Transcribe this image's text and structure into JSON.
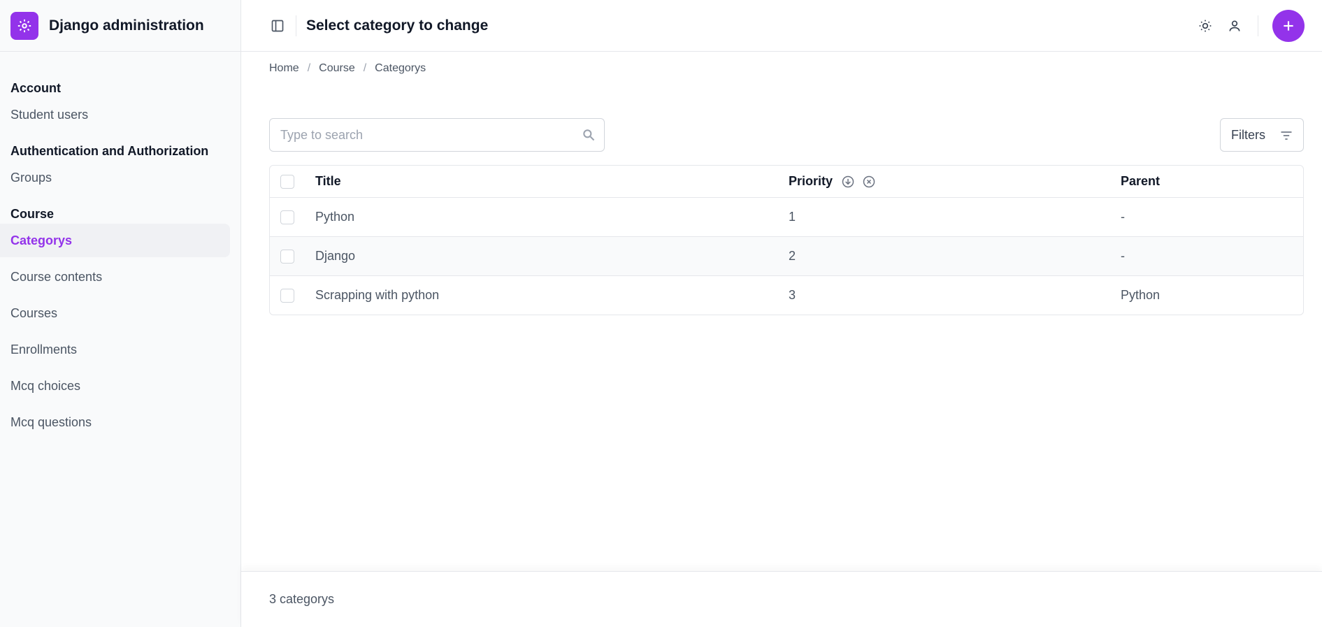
{
  "brand": {
    "title": "Django administration",
    "icon": "gear-icon"
  },
  "sidebar": {
    "groups": [
      {
        "title": "Account",
        "items": [
          {
            "label": "Student users"
          }
        ]
      },
      {
        "title": "Authentication and Authorization",
        "items": [
          {
            "label": "Groups"
          }
        ]
      },
      {
        "title": "Course",
        "items": [
          {
            "label": "Categorys",
            "active": true
          },
          {
            "label": "Course contents"
          },
          {
            "label": "Courses"
          },
          {
            "label": "Enrollments"
          },
          {
            "label": "Mcq choices"
          },
          {
            "label": "Mcq questions"
          }
        ]
      }
    ]
  },
  "header": {
    "title": "Select category to change",
    "add_icon": "plus-icon"
  },
  "breadcrumb": [
    "Home",
    "Course",
    "Categorys"
  ],
  "search": {
    "placeholder": "Type to search",
    "value": ""
  },
  "filters": {
    "label": "Filters"
  },
  "table": {
    "columns": [
      "Title",
      "Priority",
      "Parent"
    ],
    "rows": [
      {
        "title": "Python",
        "priority": "1",
        "parent": "-"
      },
      {
        "title": "Django",
        "priority": "2",
        "parent": "-"
      },
      {
        "title": "Scrapping with python",
        "priority": "3",
        "parent": "Python"
      }
    ]
  },
  "footer": {
    "count": "3 categorys"
  },
  "colors": {
    "accent": "#9333ea",
    "sidebar_bg": "#f9fafb",
    "border": "#e5e7eb"
  }
}
